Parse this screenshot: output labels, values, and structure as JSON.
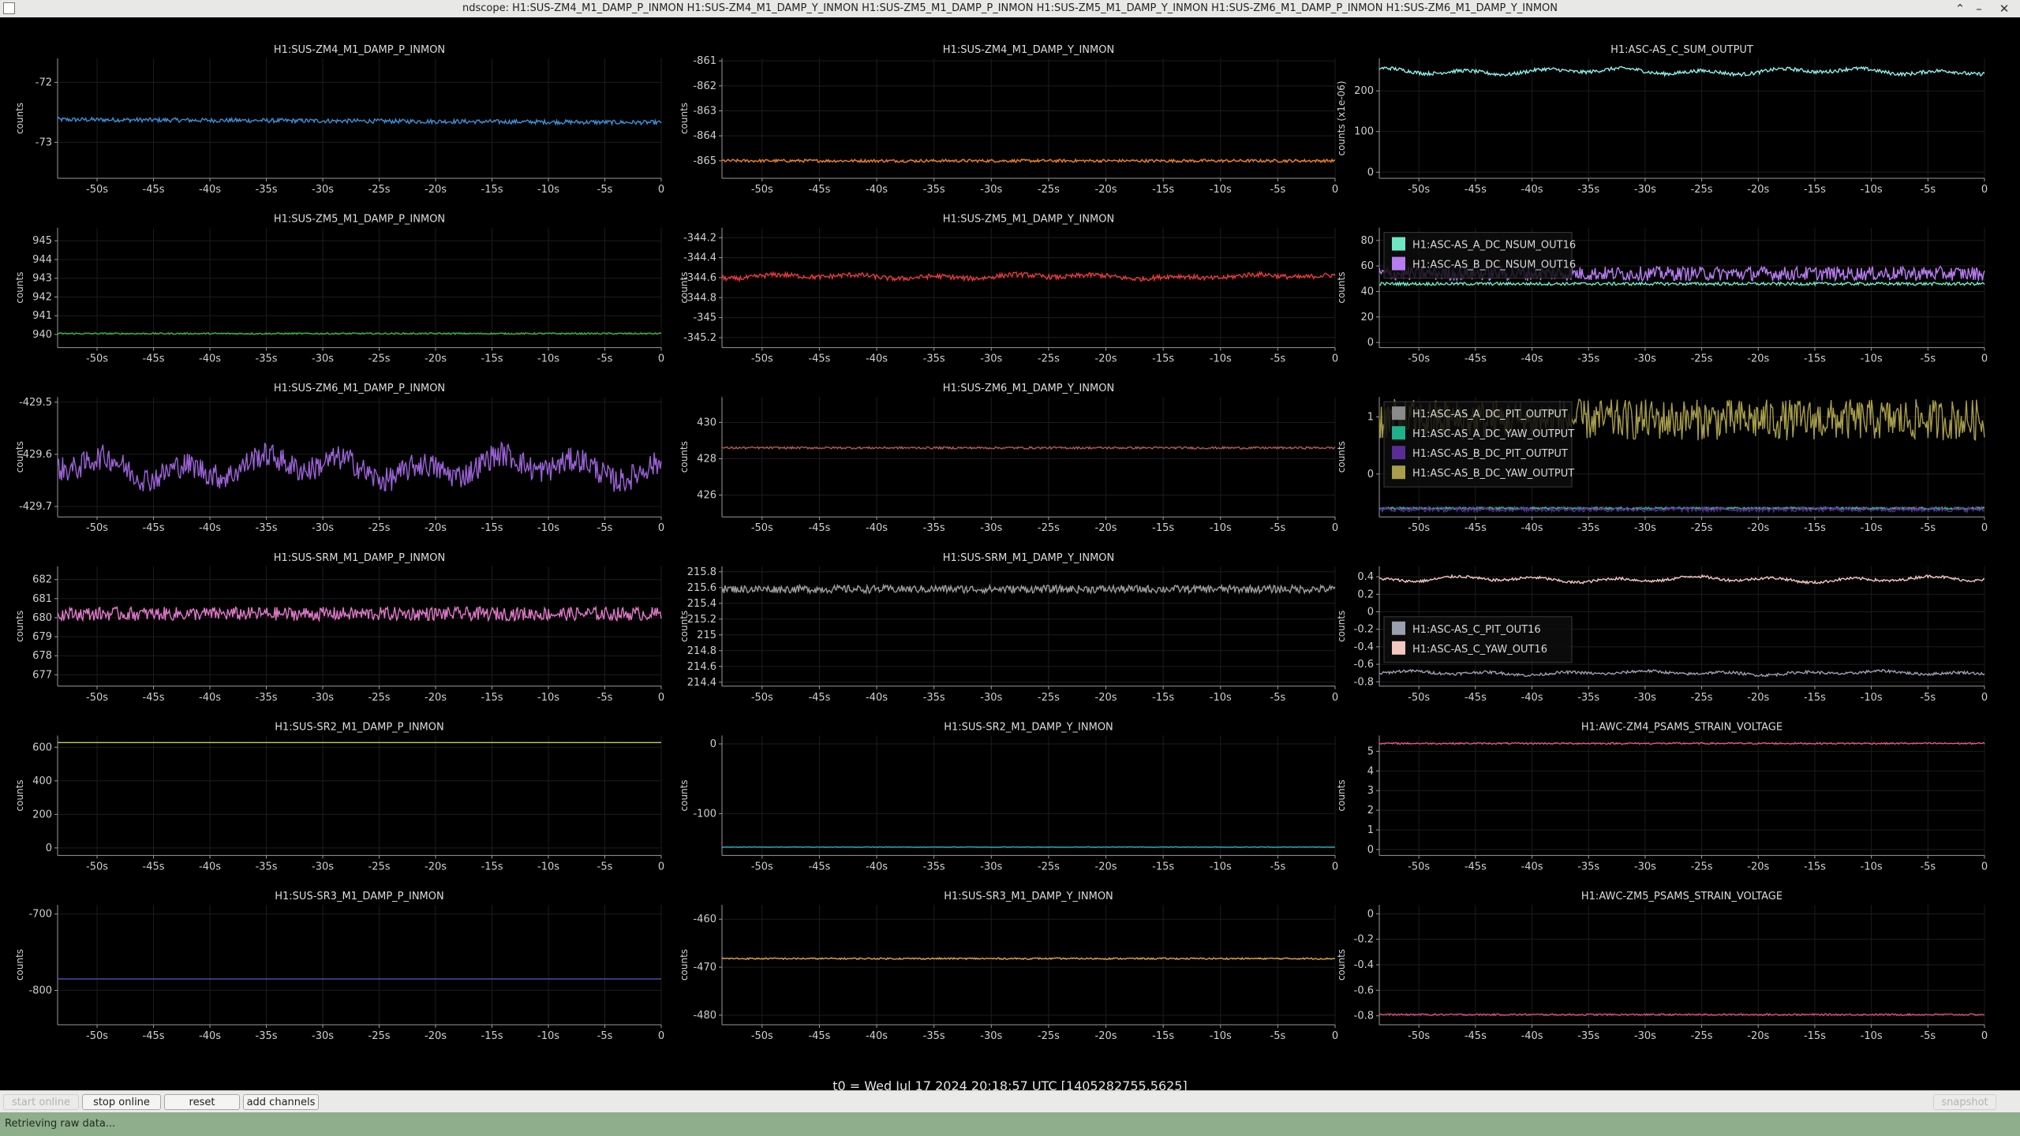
{
  "window": {
    "title": "ndscope: H1:SUS-ZM4_M1_DAMP_P_INMON H1:SUS-ZM4_M1_DAMP_Y_INMON H1:SUS-ZM5_M1_DAMP_P_INMON H1:SUS-ZM5_M1_DAMP_Y_INMON H1:SUS-ZM6_M1_DAMP_P_INMON H1:SUS-ZM6_M1_DAMP_Y_INMON",
    "controls": [
      "minimize-icon",
      "restore-icon",
      "close-icon"
    ]
  },
  "time_axis": {
    "ticks": [
      "-50s",
      "-45s",
      "-40s",
      "-35s",
      "-30s",
      "-25s",
      "-20s",
      "-15s",
      "-10s",
      "-5s",
      "0"
    ],
    "tick_values": [
      -50,
      -45,
      -40,
      -35,
      -30,
      -25,
      -20,
      -15,
      -10,
      -5,
      0
    ],
    "range": [
      -53.5,
      0
    ]
  },
  "t0": "t0 = Wed Jul 17 2024 20:18:57 UTC [1405282755.5625]",
  "toolbar": {
    "start_online": "start online",
    "stop_online": "stop online",
    "reset": "reset",
    "add_channels": "add channels",
    "snapshot": "snapshot"
  },
  "status": "Retrieving raw data...",
  "chart_data": [
    {
      "type": "line",
      "title": "H1:SUS-ZM4_M1_DAMP_P_INMON",
      "ylabel": "counts",
      "yticks": [
        -72,
        -73
      ],
      "ylim": [
        -73.6,
        -71.6
      ],
      "series": [
        {
          "color": "#3d8fd6",
          "level": -72.62,
          "noise": 0.018,
          "drift": -0.05
        }
      ]
    },
    {
      "type": "line",
      "title": "H1:SUS-ZM4_M1_DAMP_Y_INMON",
      "ylabel": "counts",
      "yticks": [
        -861,
        -862,
        -863,
        -864,
        -865
      ],
      "ylim": [
        -865.7,
        -860.9
      ],
      "series": [
        {
          "color": "#f07f2a",
          "level": -865.0,
          "noise": 0.03
        }
      ]
    },
    {
      "type": "line",
      "title": "H1:ASC-AS_C_SUM_OUTPUT",
      "ylabel": "counts (x1e-06)",
      "yticks": [
        0,
        100,
        200
      ],
      "ylim": [
        -15,
        280
      ],
      "series": [
        {
          "color": "#8df0ec",
          "level": 248,
          "noise": 2.2,
          "wander": 7
        }
      ]
    },
    {
      "type": "line",
      "title": "H1:SUS-ZM5_M1_DAMP_P_INMON",
      "ylabel": "counts",
      "yticks": [
        940,
        941,
        942,
        943,
        944,
        945
      ],
      "ylim": [
        939.3,
        945.7
      ],
      "series": [
        {
          "color": "#3cb83a",
          "level": 940.05,
          "noise": 0.02
        }
      ]
    },
    {
      "type": "line",
      "title": "H1:SUS-ZM5_M1_DAMP_Y_INMON",
      "ylabel": "counts",
      "yticks": [
        -344.2,
        -344.4,
        -344.6,
        -344.8,
        -345,
        -345.2
      ],
      "ylim": [
        -345.3,
        -344.1
      ],
      "series": [
        {
          "color": "#e83a3a",
          "level": -344.59,
          "noise": 0.012,
          "wander": 0.02
        }
      ]
    },
    {
      "type": "line",
      "title": "",
      "ylabel": "counts",
      "yticks": [
        0,
        20,
        40,
        60,
        80
      ],
      "ylim": [
        -4,
        90
      ],
      "legend": "top-left",
      "series": [
        {
          "name": "H1:ASC-AS_A_DC_NSUM_OUT16",
          "color": "#6ee8c3",
          "level": 46,
          "noise": 0.6
        },
        {
          "name": "H1:ASC-AS_B_DC_NSUM_OUT16",
          "color": "#b77cf0",
          "level": 54,
          "noise": 2.8
        }
      ]
    },
    {
      "type": "line",
      "title": "H1:SUS-ZM6_M1_DAMP_P_INMON",
      "ylabel": "counts",
      "yticks": [
        -429.5,
        -429.6,
        -429.7
      ],
      "ylim": [
        -429.72,
        -429.49
      ],
      "series": [
        {
          "color": "#9a62d6",
          "level": -429.625,
          "noise": 0.012,
          "wander": 0.022
        }
      ]
    },
    {
      "type": "line",
      "title": "H1:SUS-ZM6_M1_DAMP_Y_INMON",
      "ylabel": "counts",
      "yticks": [
        430,
        428,
        426
      ],
      "ylim": [
        424.8,
        431.4
      ],
      "series": [
        {
          "color": "#b35a4e",
          "level": 428.6,
          "noise": 0.03
        }
      ]
    },
    {
      "type": "line",
      "title": "",
      "ylabel": "counts",
      "yticks": [
        1,
        0
      ],
      "ylim": [
        -0.75,
        1.35
      ],
      "legend": "top-left",
      "series": [
        {
          "name": "H1:ASC-AS_A_DC_PIT_OUTPUT",
          "color": "#8a8a8a",
          "level": -0.6,
          "noise": 0.01
        },
        {
          "name": "H1:ASC-AS_A_DC_YAW_OUTPUT",
          "color": "#1fb08c",
          "level": -0.6,
          "noise": 0.01
        },
        {
          "name": "H1:ASC-AS_B_DC_PIT_OUTPUT",
          "color": "#5a2d96",
          "level": -0.62,
          "noise": 0.02
        },
        {
          "name": "H1:ASC-AS_B_DC_YAW_OUTPUT",
          "color": "#a79d4a",
          "level": 0.95,
          "noise": 0.18
        }
      ]
    },
    {
      "type": "line",
      "title": "H1:SUS-SRM_M1_DAMP_P_INMON",
      "ylabel": "counts",
      "yticks": [
        682,
        681,
        680,
        679,
        678,
        677
      ],
      "ylim": [
        676.4,
        682.7
      ],
      "series": [
        {
          "color": "#e078c8",
          "level": 680.2,
          "noise": 0.18
        }
      ]
    },
    {
      "type": "line",
      "title": "H1:SUS-SRM_M1_DAMP_Y_INMON",
      "ylabel": "counts",
      "yticks": [
        215.8,
        215.6,
        215.4,
        215.2,
        215,
        214.8,
        214.6,
        214.4
      ],
      "ylim": [
        214.35,
        215.87
      ],
      "series": [
        {
          "color": "#9d9d9d",
          "level": 215.58,
          "noise": 0.025
        }
      ]
    },
    {
      "type": "line",
      "title": "",
      "ylabel": "counts",
      "yticks": [
        0.4,
        0.2,
        0,
        -0.2,
        -0.4,
        -0.6,
        -0.8
      ],
      "ylim": [
        -0.85,
        0.52
      ],
      "legend": "bottom-left",
      "series": [
        {
          "name": "H1:ASC-AS_C_PIT_OUT16",
          "color": "#9aa0ad",
          "level": -0.7,
          "noise": 0.008,
          "wander": 0.02
        },
        {
          "name": "H1:ASC-AS_C_YAW_OUT16",
          "color": "#f4c8c0",
          "level": 0.37,
          "noise": 0.008,
          "wander": 0.03
        }
      ]
    },
    {
      "type": "line",
      "title": "H1:SUS-SR2_M1_DAMP_P_INMON",
      "ylabel": "counts",
      "yticks": [
        600,
        400,
        200,
        0
      ],
      "ylim": [
        -45,
        670
      ],
      "series": [
        {
          "color": "#c8cf4a",
          "level": 628,
          "noise": 0
        }
      ]
    },
    {
      "type": "line",
      "title": "H1:SUS-SR2_M1_DAMP_Y_INMON",
      "ylabel": "counts",
      "yticks": [
        0,
        -100
      ],
      "ylim": [
        -160,
        12
      ],
      "series": [
        {
          "color": "#2ab7c9",
          "level": -148,
          "noise": 0.2
        }
      ]
    },
    {
      "type": "line",
      "title": "H1:AWC-ZM4_PSAMS_STRAIN_VOLTAGE",
      "ylabel": "counts",
      "yticks": [
        5,
        4,
        3,
        2,
        1,
        0
      ],
      "ylim": [
        -0.3,
        5.8
      ],
      "series": [
        {
          "color": "#e8578b",
          "level": 5.4,
          "noise": 0.02
        }
      ]
    },
    {
      "type": "line",
      "title": "H1:SUS-SR3_M1_DAMP_P_INMON",
      "ylabel": "counts",
      "yticks": [
        -700,
        -800
      ],
      "ylim": [
        -845,
        -688
      ],
      "series": [
        {
          "color": "#4a55b8",
          "level": -785,
          "noise": 0
        }
      ]
    },
    {
      "type": "line",
      "title": "H1:SUS-SR3_M1_DAMP_Y_INMON",
      "ylabel": "counts",
      "yticks": [
        -460,
        -470,
        -480
      ],
      "ylim": [
        -482,
        -457
      ],
      "series": [
        {
          "color": "#e2a744",
          "level": -468.2,
          "noise": 0.08
        }
      ]
    },
    {
      "type": "line",
      "title": "H1:AWC-ZM5_PSAMS_STRAIN_VOLTAGE",
      "ylabel": "counts",
      "yticks": [
        0,
        -0.2,
        -0.4,
        -0.6,
        -0.8
      ],
      "ylim": [
        -0.87,
        0.07
      ],
      "series": [
        {
          "color": "#d8508a",
          "level": -0.79,
          "noise": 0.003
        }
      ]
    }
  ]
}
